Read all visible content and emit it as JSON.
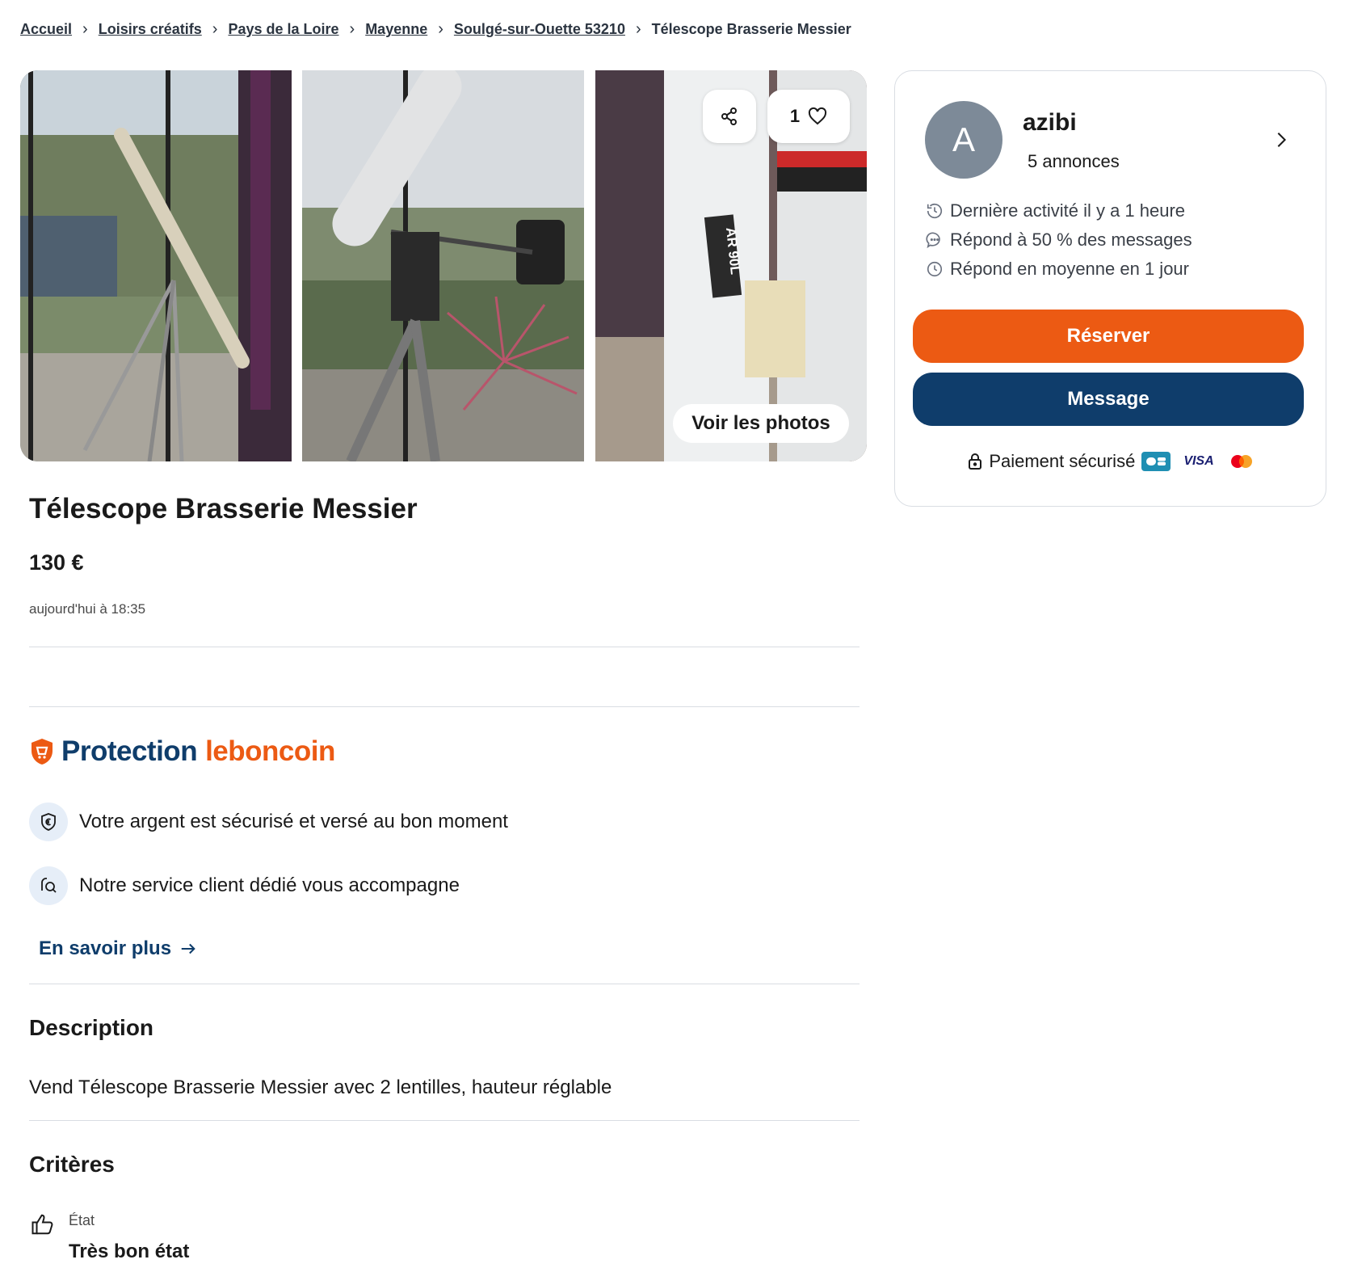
{
  "breadcrumb": {
    "items": [
      "Accueil",
      "Loisirs créatifs",
      "Pays de la Loire",
      "Mayenne",
      "Soulgé-sur-Ouette 53210"
    ],
    "current": "Télescope Brasserie Messier"
  },
  "gallery": {
    "favorite_count": "1",
    "see_photos_label": "Voir les photos",
    "photo3_label": "AR 90L"
  },
  "listing": {
    "title": "Télescope Brasserie Messier",
    "price": "130 €",
    "date": "aujourd'hui à 18:35"
  },
  "protection": {
    "brand_part1": "Protection",
    "brand_part2": "leboncoin",
    "features": [
      "Votre argent est sécurisé et versé au bon moment",
      "Notre service client dédié vous accompagne"
    ],
    "learn_more": "En savoir plus"
  },
  "description": {
    "heading": "Description",
    "text": "Vend Télescope Brasserie Messier avec 2 lentilles, hauteur réglable"
  },
  "criteria": {
    "heading": "Critères",
    "label": "État",
    "value": "Très bon état"
  },
  "seller": {
    "avatar_letter": "A",
    "name": "azibi",
    "listings": "5 annonces",
    "stats": [
      "Dernière activité il y a 1 heure",
      "Répond à 50 % des messages",
      "Répond en moyenne en 1 jour"
    ],
    "reserve_label": "Réserver",
    "message_label": "Message",
    "payment_label": "Paiement sécurisé",
    "payment_visa": "VISA"
  },
  "colors": {
    "orange": "#ec5a13",
    "navy": "#0f3d6b",
    "avatar": "#7d8a98"
  },
  "icons": [
    "chevron-right-icon",
    "share-icon",
    "heart-icon",
    "shield-icon",
    "euro-shield-icon",
    "chat-search-icon",
    "arrow-right-icon",
    "thumbs-up-icon",
    "history-icon",
    "chat-icon",
    "clock-icon",
    "lock-icon",
    "cb-card-icon",
    "mastercard-icon"
  ]
}
